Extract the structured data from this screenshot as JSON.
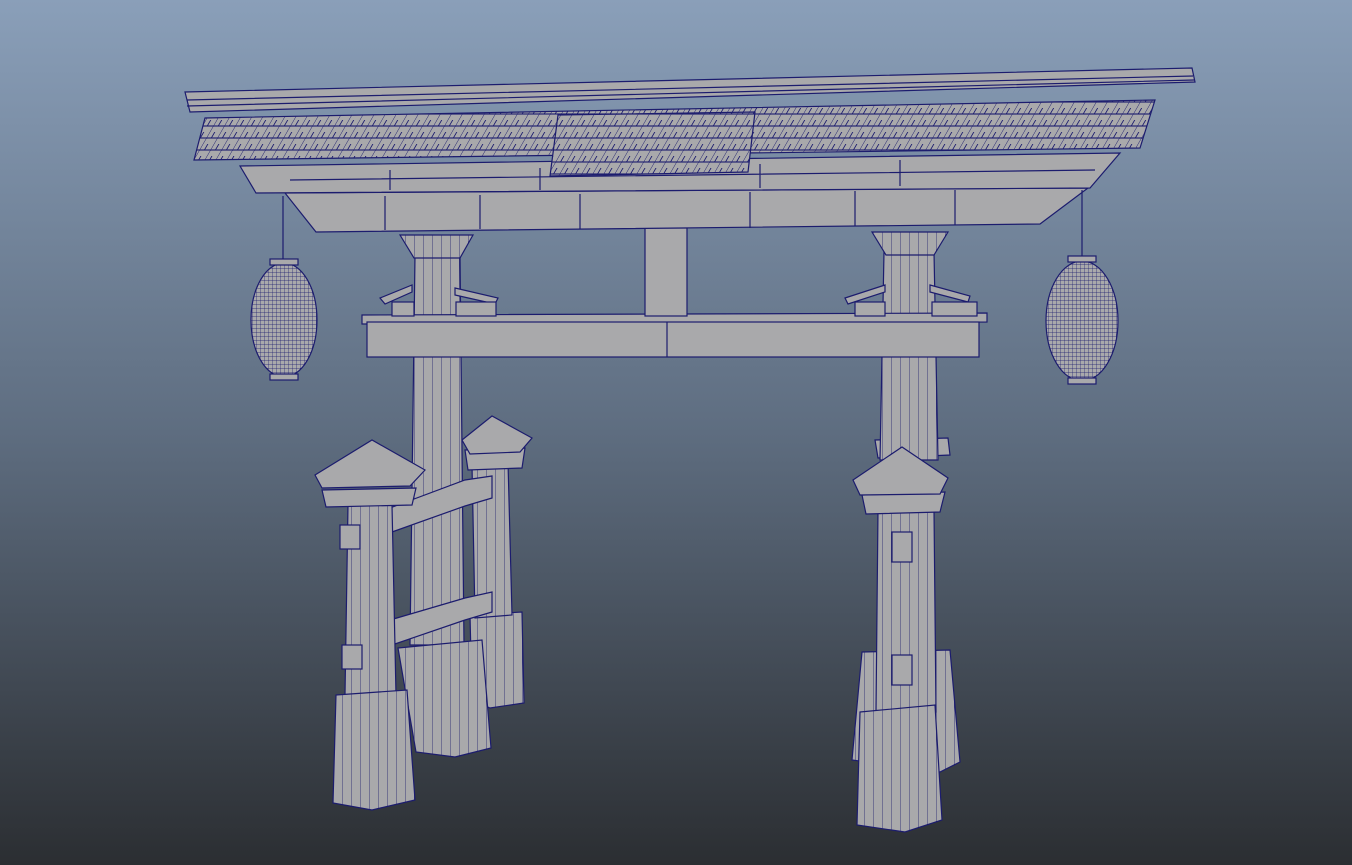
{
  "viewport": {
    "background_top": "#8a9fb9",
    "background_bottom": "#2b2e32",
    "mesh_fill": "#a9a9ab",
    "wire_color": "#1c1c6e"
  }
}
